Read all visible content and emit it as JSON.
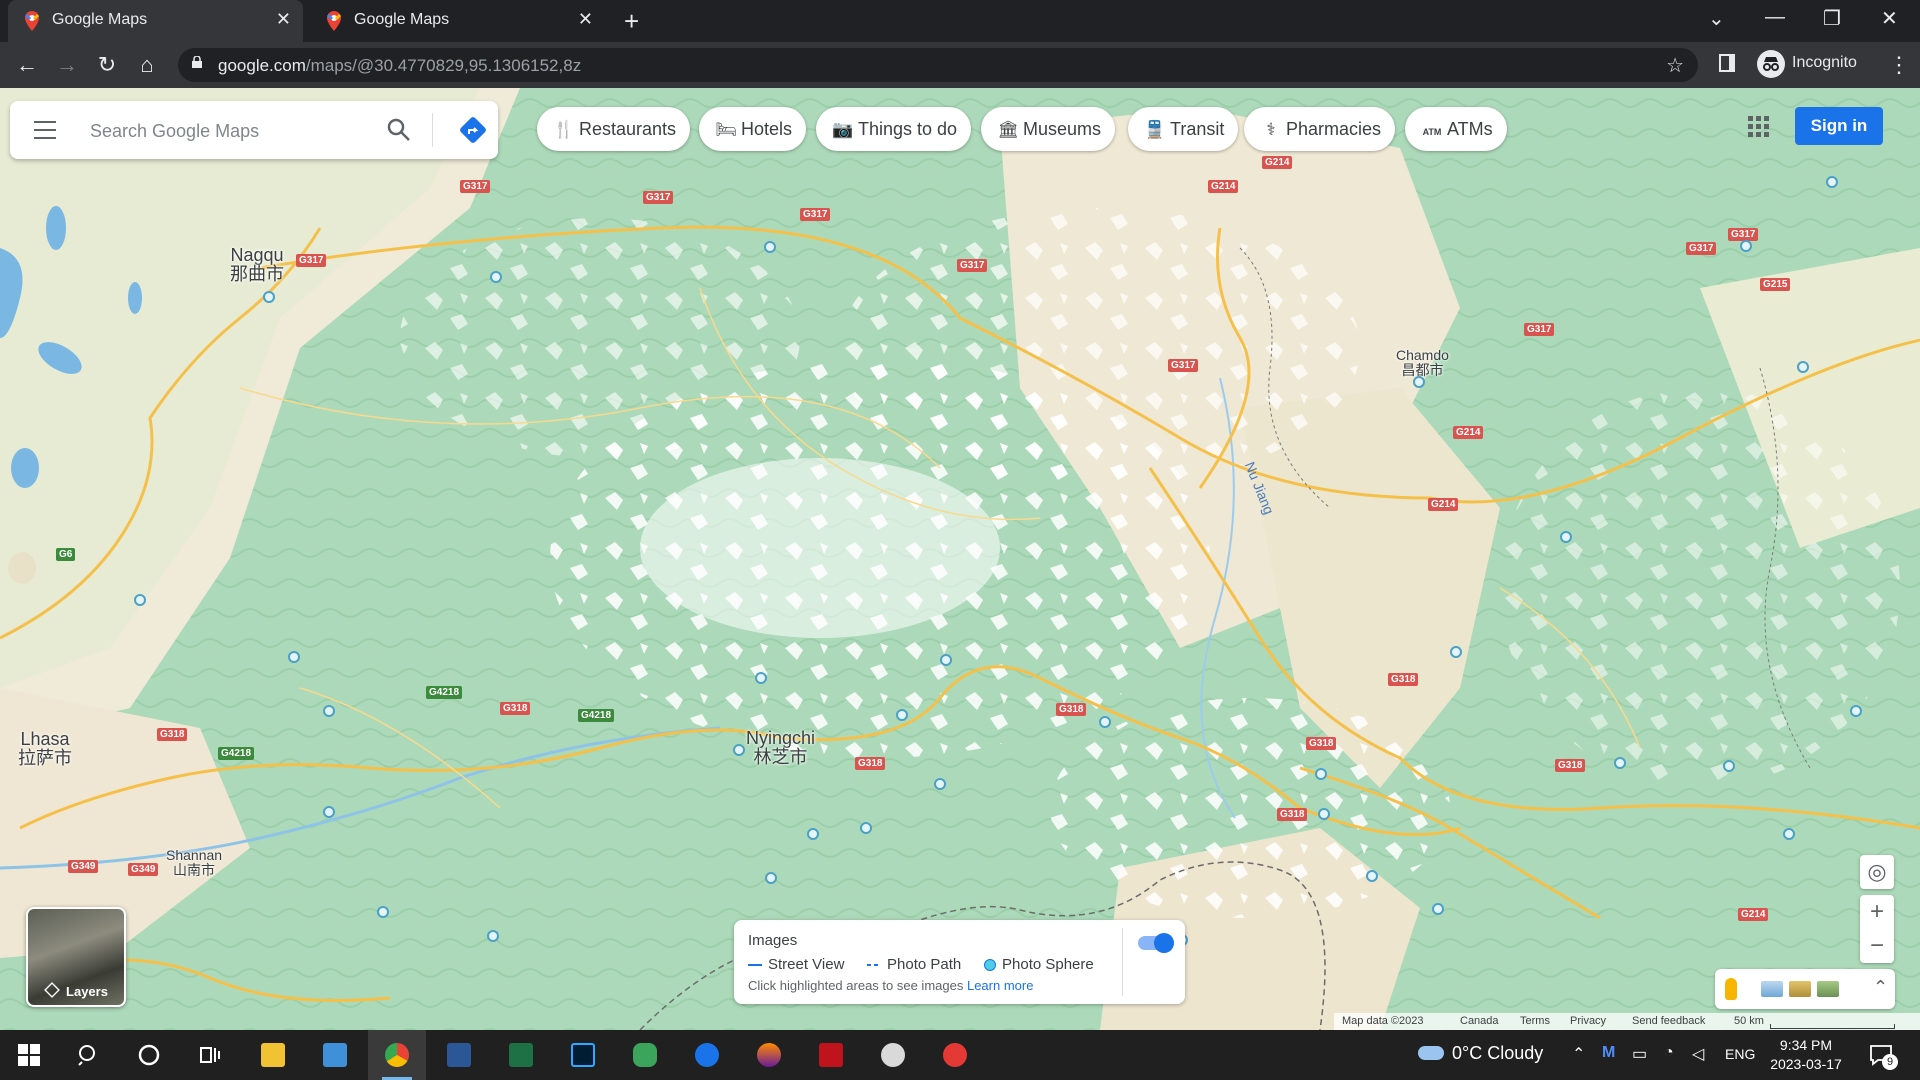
{
  "browser": {
    "tabs": [
      {
        "title": "Google Maps",
        "close": "✕"
      },
      {
        "title": "Google Maps",
        "close": "✕"
      }
    ],
    "new_tab": "+",
    "window_controls": {
      "tabsearch": "⌄",
      "minimize": "—",
      "restore": "❐",
      "close": "✕"
    },
    "nav": {
      "back": "←",
      "forward": "→",
      "reload": "↻",
      "home": "⌂"
    },
    "url_host": "google.com",
    "url_path": "/maps/@30.4770829,95.1306152,8z",
    "bookmark_star": "☆",
    "profile_label": "Incognito",
    "menu": "⋮"
  },
  "maps": {
    "search": {
      "placeholder": "Search Google Maps"
    },
    "chips": [
      {
        "icon": "restaurant-icon",
        "glyph": "🍴",
        "label": "Restaurants"
      },
      {
        "icon": "hotel-icon",
        "glyph": "🛏",
        "label": "Hotels"
      },
      {
        "icon": "camera-icon",
        "glyph": "📷",
        "label": "Things to do"
      },
      {
        "icon": "museum-icon",
        "glyph": "🏛",
        "label": "Museums"
      },
      {
        "icon": "transit-icon",
        "glyph": "🚆",
        "label": "Transit"
      },
      {
        "icon": "pharmacy-icon",
        "glyph": "⚕",
        "label": "Pharmacies"
      },
      {
        "icon": "atm-icon",
        "glyph": "ATM",
        "label": "ATMs"
      }
    ],
    "sign_in": "Sign in",
    "places": [
      {
        "name": "Nagqu",
        "local": "那曲市"
      },
      {
        "name": "Chamdo",
        "local": "昌都市"
      },
      {
        "name": "Lhasa",
        "local": "拉萨市"
      },
      {
        "name": "Nyingchi",
        "local": "林芝市"
      },
      {
        "name": "Shannan",
        "local": "山南市"
      }
    ],
    "river": "Nu Jiang",
    "shields": [
      "G317",
      "G317",
      "G317",
      "G317",
      "G317",
      "G317",
      "G317",
      "G317",
      "G317",
      "G214",
      "G214",
      "G214",
      "G214",
      "G214",
      "G215",
      "G318",
      "G318",
      "G318",
      "G318",
      "G318",
      "G318",
      "G318",
      "G318",
      "G4218",
      "G4218",
      "G4218",
      "G6",
      "G349",
      "G349"
    ],
    "layers_label": "Layers",
    "images_panel": {
      "title": "Images",
      "legend": [
        "Street View",
        "Photo Path",
        "Photo Sphere"
      ],
      "hint": "Click highlighted areas to see images",
      "learn_more": "Learn more",
      "toggle_on": true
    },
    "controls": {
      "locate": "◎",
      "zoom_in": "+",
      "zoom_out": "−",
      "expand": "⌃"
    },
    "footer": {
      "map_data": "Map data ©2023",
      "region": "Canada",
      "terms": "Terms",
      "privacy": "Privacy",
      "feedback": "Send feedback",
      "scale": "50 km"
    }
  },
  "taskbar": {
    "weather": "0°C  Cloudy",
    "lang": "ENG",
    "time": "9:34 PM",
    "date": "2023-03-17",
    "notifications": "9"
  },
  "colors": {
    "accent": "#1a73e8",
    "map_green": "#a9d8b6",
    "map_land": "#f2eadb",
    "road": "#f5c04a",
    "shield_red": "#d9534f",
    "chrome_dark": "#202124"
  }
}
